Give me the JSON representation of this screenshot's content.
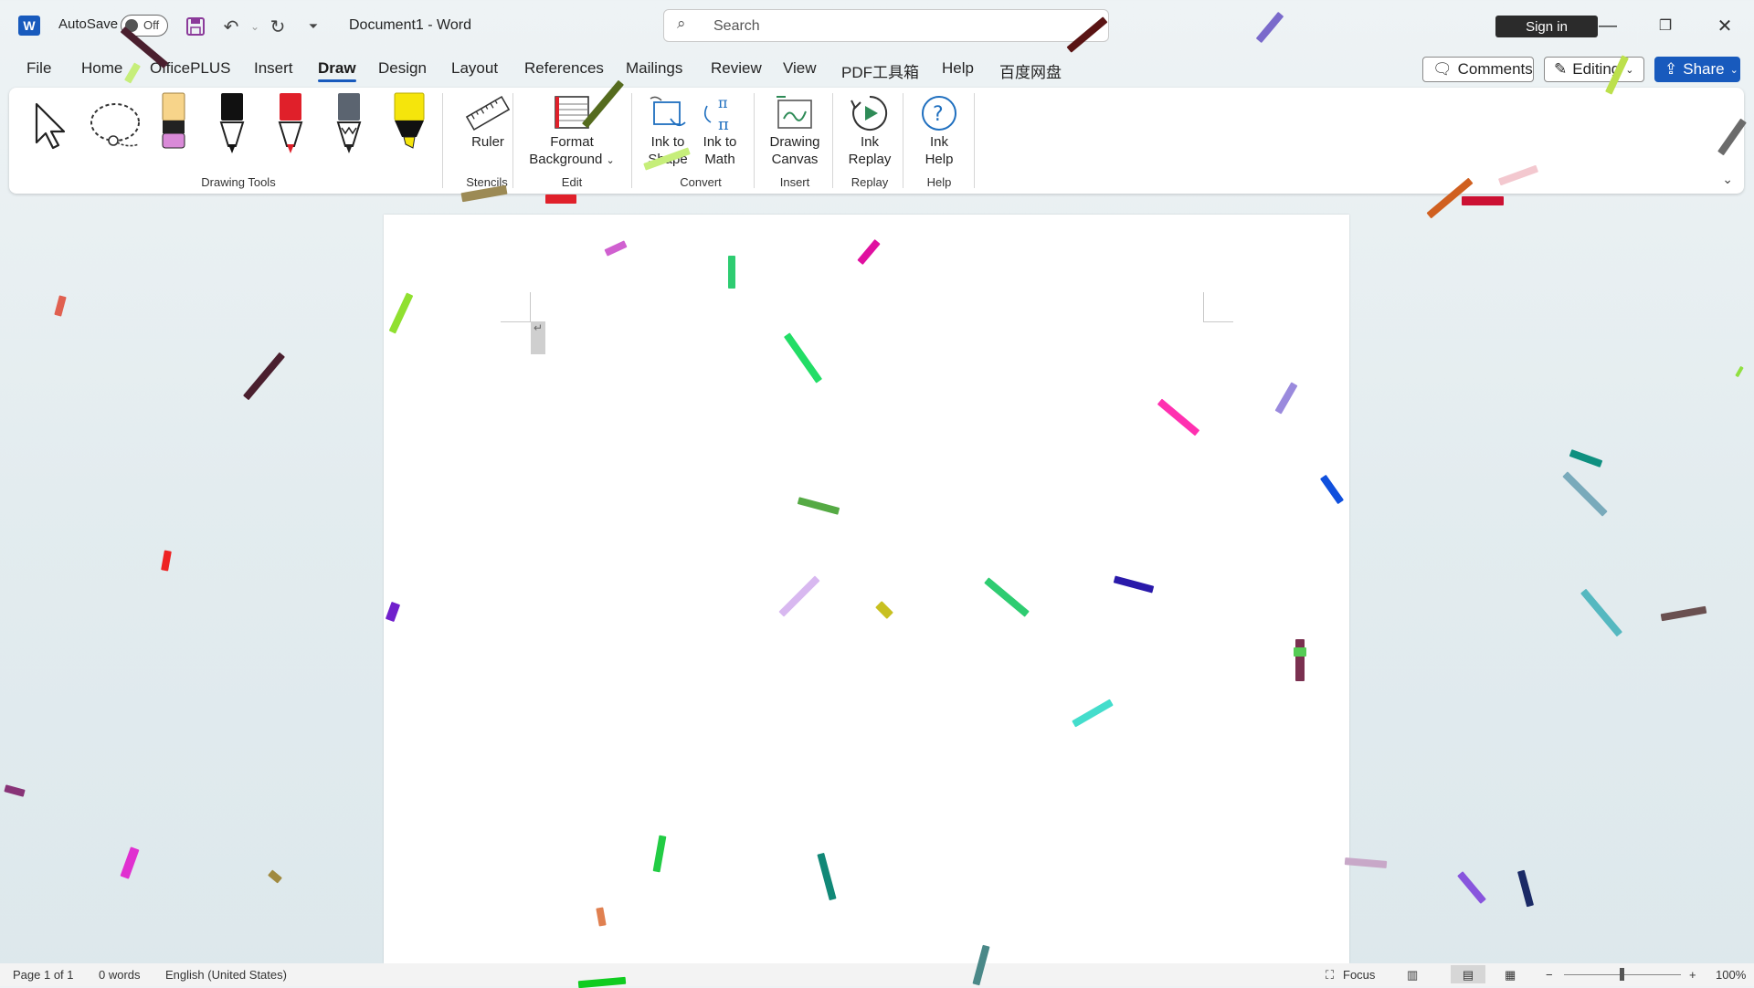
{
  "app": {
    "logo_letter": "W",
    "autosave_label": "AutoSave",
    "autosave_state": "Off",
    "document_title": "Document1  -  Word",
    "search_placeholder": "Search",
    "signin_label": "Sign in"
  },
  "menu": {
    "tabs": [
      "File",
      "Home",
      "OfficePLUS",
      "Insert",
      "Draw",
      "Design",
      "Layout",
      "References",
      "Mailings",
      "Review",
      "View",
      "PDF工具箱",
      "Help",
      "百度网盘"
    ],
    "active_tab": "Draw",
    "comments_label": "Comments",
    "editing_label": "Editing",
    "share_label": "Share"
  },
  "ribbon": {
    "ruler_label": "Ruler",
    "format_background_label_1": "Format",
    "format_background_label_2": "Background",
    "ink_to_shape_1": "Ink to",
    "ink_to_shape_2": "Shape",
    "ink_to_math_1": "Ink to",
    "ink_to_math_2": "Math",
    "drawing_canvas_1": "Drawing",
    "drawing_canvas_2": "Canvas",
    "ink_replay_1": "Ink",
    "ink_replay_2": "Replay",
    "ink_help_1": "Ink",
    "ink_help_2": "Help",
    "groups": {
      "drawing_tools": "Drawing Tools",
      "stencils": "Stencils",
      "edit": "Edit",
      "convert": "Convert",
      "insert": "Insert",
      "replay": "Replay",
      "help": "Help"
    },
    "pen_colors": [
      "#f7d48a",
      "#111111",
      "#e0202a",
      "#5b6470",
      "#f5e50c"
    ]
  },
  "status": {
    "page": "Page 1 of 1",
    "words": "0 words",
    "language": "English (United States)",
    "focus": "Focus",
    "zoom": "100%"
  }
}
